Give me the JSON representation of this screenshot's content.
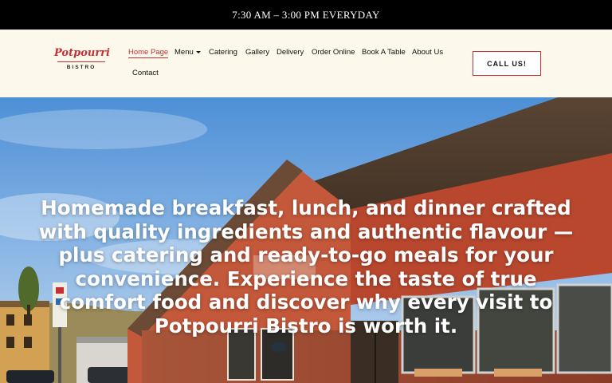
{
  "topbar": {
    "hours": "7:30 AM – 3:00 PM EVERYDAY"
  },
  "logo": {
    "script": "Potpourri",
    "sub": "BISTRO"
  },
  "nav": {
    "home": "Home Page",
    "menu": "Menu",
    "catering": "Catering",
    "gallery": "Gallery",
    "delivery": "Delivery",
    "order_online": "Order Online",
    "book_table": "Book A Table",
    "about": "About Us",
    "contact": "Contact"
  },
  "cta": {
    "label": "CALL US!"
  },
  "hero": {
    "text": "Homemade breakfast, lunch, and dinner crafted with quality ingredients and authentic flavour — plus catering and ready-to-go meals for your convenience. Experience the taste of true comfort food and discover why every visit to Potpourri Bistro is worth it."
  },
  "colors": {
    "accent": "#c62f33",
    "cream": "#fdf8ec",
    "topbar": "#000000"
  }
}
